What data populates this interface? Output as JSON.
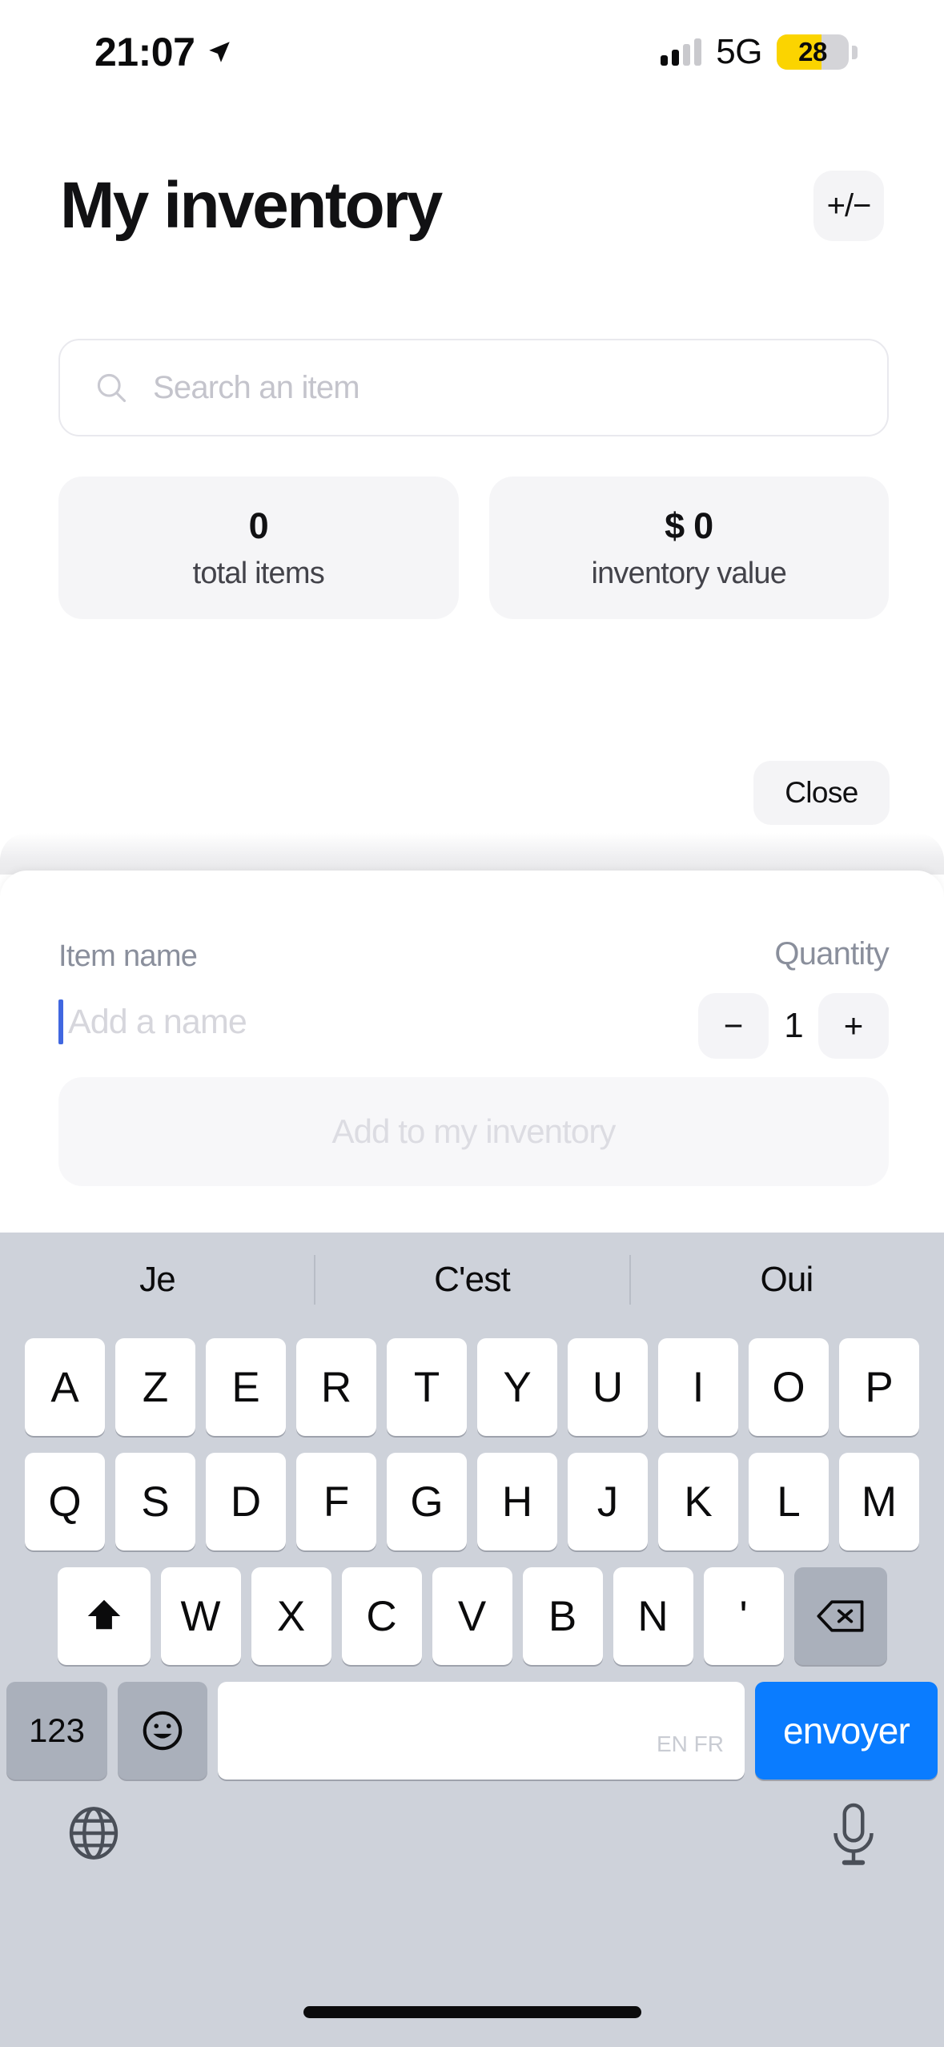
{
  "status_bar": {
    "time": "21:07",
    "location_icon": "location-arrow-icon",
    "signal_icon": "cellular-signal-icon",
    "network": "5G",
    "battery_percent": "28",
    "battery_color": "#fbd400"
  },
  "header": {
    "title": "My inventory",
    "toggle_label": "+/−"
  },
  "search": {
    "placeholder": "Search an item",
    "icon": "search-icon"
  },
  "stats": [
    {
      "value": "0",
      "label": "total items"
    },
    {
      "value": "$ 0",
      "label": "inventory value"
    }
  ],
  "close_button": {
    "label": "Close"
  },
  "sheet": {
    "item_name_label": "Item name",
    "item_name_placeholder": "Add a name",
    "quantity_label": "Quantity",
    "quantity_value": "1",
    "minus_label": "−",
    "plus_label": "+",
    "submit_label": "Add to my inventory",
    "caret_color": "#4067e0"
  },
  "keyboard": {
    "layout": "AZERTY",
    "predictions": [
      "Je",
      "C'est",
      "Oui"
    ],
    "row1": [
      "A",
      "Z",
      "E",
      "R",
      "T",
      "Y",
      "U",
      "I",
      "O",
      "P"
    ],
    "row2": [
      "Q",
      "S",
      "D",
      "F",
      "G",
      "H",
      "J",
      "K",
      "L",
      "M"
    ],
    "row3": [
      "W",
      "X",
      "C",
      "V",
      "B",
      "N",
      "'"
    ],
    "shift_icon": "shift-up-arrow-icon",
    "backspace_icon": "backspace-delete-icon",
    "numeric_label": "123",
    "emoji_icon": "emoji-smiley-icon",
    "space_languages": "EN FR",
    "send_label": "envoyer",
    "send_color": "#0a7cff",
    "globe_icon": "globe-language-icon",
    "mic_icon": "microphone-dictation-icon"
  }
}
